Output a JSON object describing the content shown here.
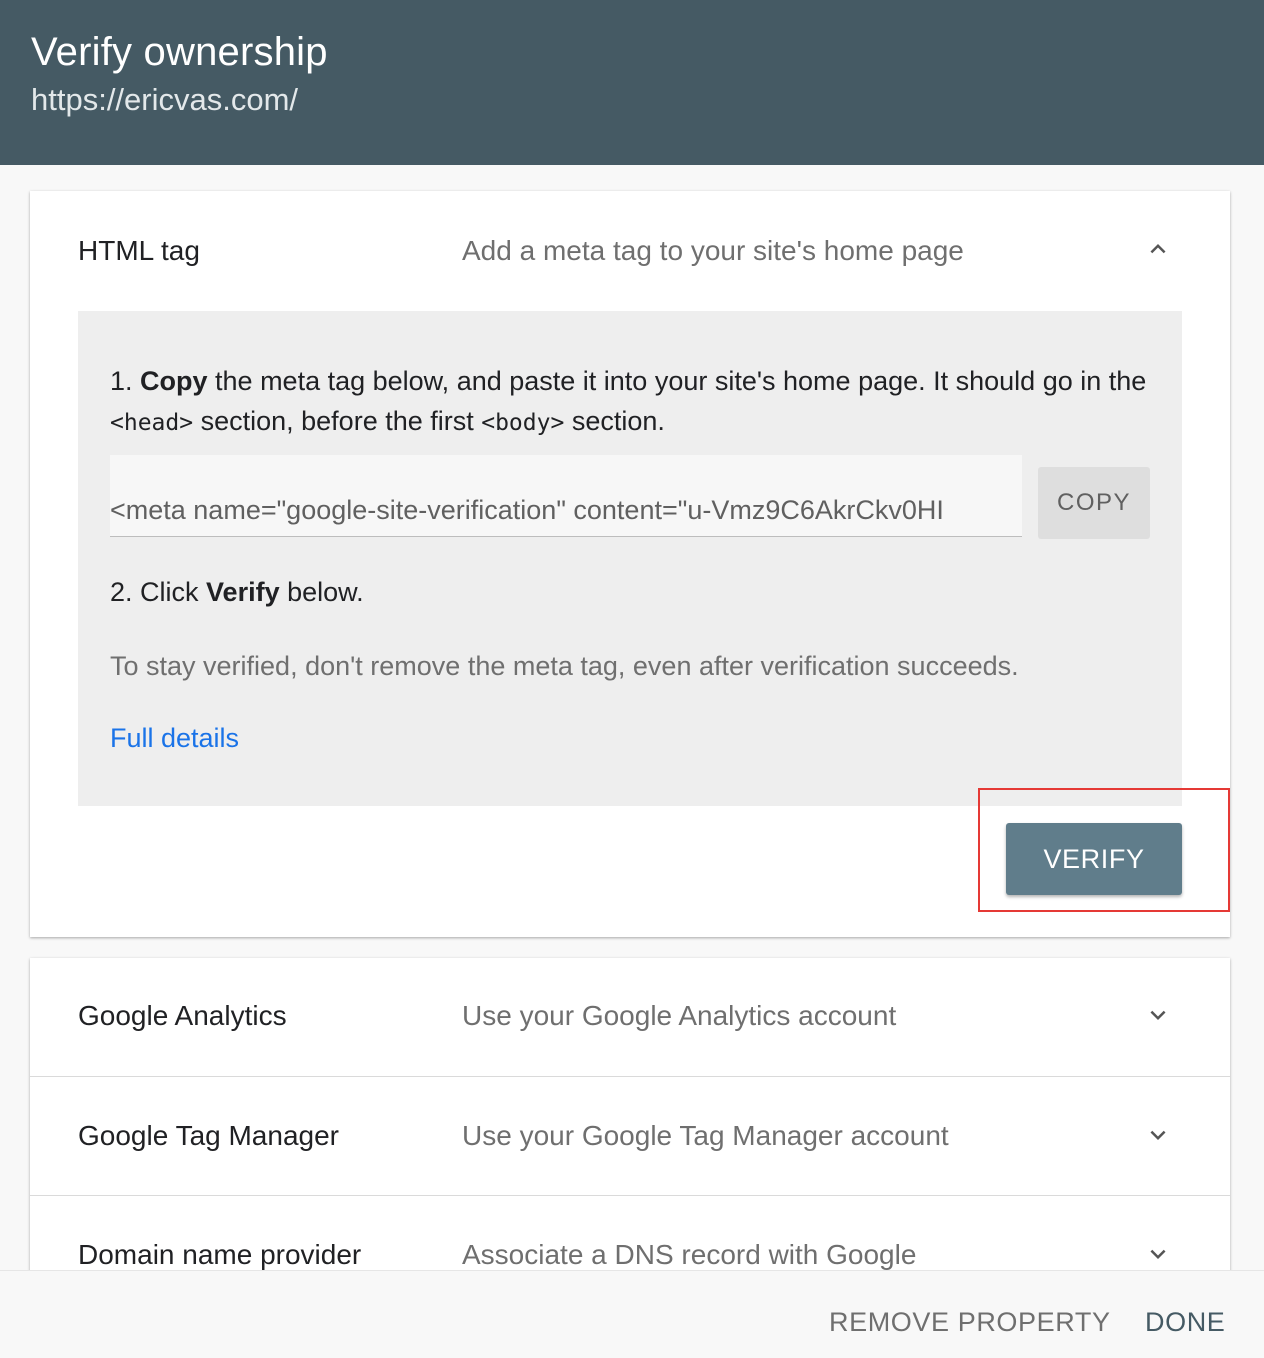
{
  "header": {
    "title": "Verify ownership",
    "site_url": "https://ericvas.com/"
  },
  "html_tag": {
    "label": "HTML tag",
    "description": "Add a meta tag to your site's home page",
    "expanded": true,
    "step1": {
      "prefix": "1. ",
      "bold": "Copy",
      "text_a": " the meta tag below, and paste it into your site's home page. It should go in the ",
      "head_tag": "<head>",
      "text_b": " section, before the first ",
      "body_tag": "<body>",
      "text_c": " section."
    },
    "meta_tag_value": "<meta name=\"google-site-verification\" content=\"u-Vmz9C6AkrCkv0HI",
    "copy_label": "COPY",
    "step2": {
      "prefix": "2. Click ",
      "bold": "Verify",
      "suffix": " below."
    },
    "note": "To stay verified, don't remove the meta tag, even after verification succeeds.",
    "full_details": "Full details",
    "verify_label": "VERIFY"
  },
  "methods": [
    {
      "label": "Google Analytics",
      "description": "Use your Google Analytics account",
      "icon": "chevron-down-icon"
    },
    {
      "label": "Google Tag Manager",
      "description": "Use your Google Tag Manager account",
      "icon": "chevron-down-icon"
    },
    {
      "label": "Domain name provider",
      "description": "Associate a DNS record with Google",
      "icon": "chevron-down-icon"
    }
  ],
  "footer": {
    "remove_label": "REMOVE PROPERTY",
    "done_label": "DONE"
  },
  "colors": {
    "header_bg": "#455a64",
    "verify_button": "#607d8b",
    "link": "#1a73e8",
    "highlight_border": "#e53935"
  }
}
